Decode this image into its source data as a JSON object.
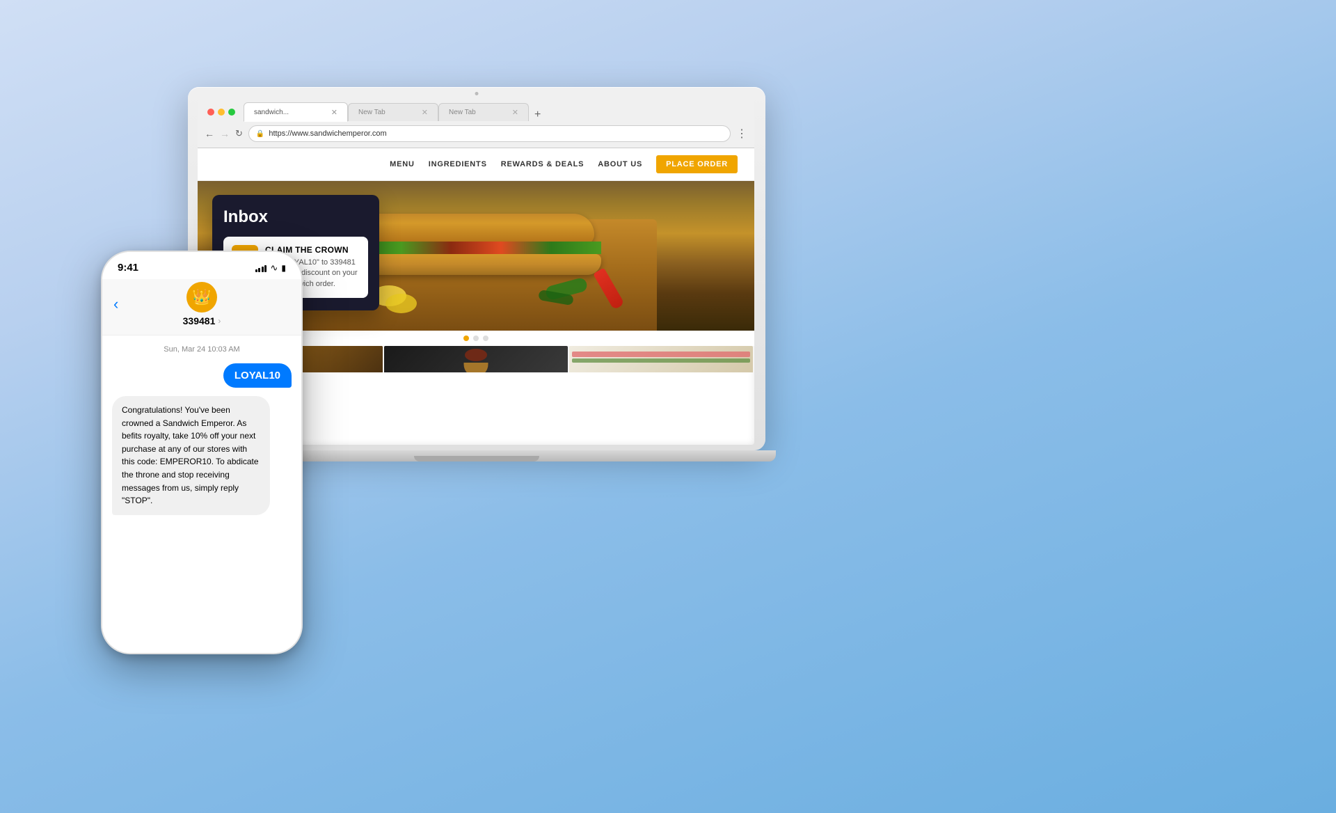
{
  "background": {
    "gradient_start": "#c8d8f0",
    "gradient_end": "#6aabdf"
  },
  "laptop": {
    "url": "https://www.sandwichemperor.com",
    "website": {
      "nav": {
        "menu": "MENU",
        "ingredients": "INGREDIENTS",
        "rewards": "REWARDS & DEALS",
        "about_us": "ABOUT US",
        "place_order": "PLACE ORDER"
      },
      "hero": {
        "dots": [
          true,
          false,
          false
        ]
      }
    }
  },
  "inbox": {
    "title": "Inbox",
    "message": {
      "crown_emoji": "👑",
      "title": "CLAIM THE CROWN",
      "body": "Text \"LOYAL10\" to 339481 for a royal discount on your next sandwich order."
    }
  },
  "phone": {
    "time": "9:41",
    "contact": {
      "name": "339481",
      "crown_emoji": "👑"
    },
    "date_label": "Sun, Mar 24  10:03 AM",
    "sent_message": "LOYAL10",
    "received_message": "Congratulations! You've been crowned a Sandwich Emperor. As befits royalty, take 10% off your next purchase at any of our stores with this code: EMPEROR10. To abdicate the throne and stop receiving messages from us, simply reply \"STOP\"."
  }
}
